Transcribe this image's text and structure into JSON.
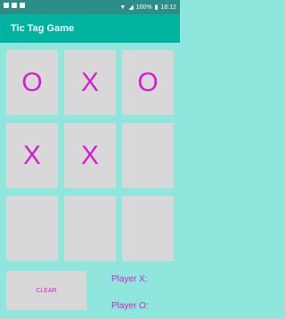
{
  "status_bar": {
    "battery_text": "100%",
    "time": "18:12"
  },
  "app_bar": {
    "title": "Tic Tag Game"
  },
  "board": {
    "cells": [
      "O",
      "X",
      "O",
      "X",
      "X",
      "",
      "",
      "",
      ""
    ]
  },
  "controls": {
    "clear_label": "CLEAR",
    "player_x_label": "Player X:",
    "player_o_label": "Player O:"
  },
  "colors": {
    "mark": "#d61ed0",
    "app_bar": "#00b3a0",
    "background": "#8ee6dd",
    "cell": "#d8d8d8"
  }
}
